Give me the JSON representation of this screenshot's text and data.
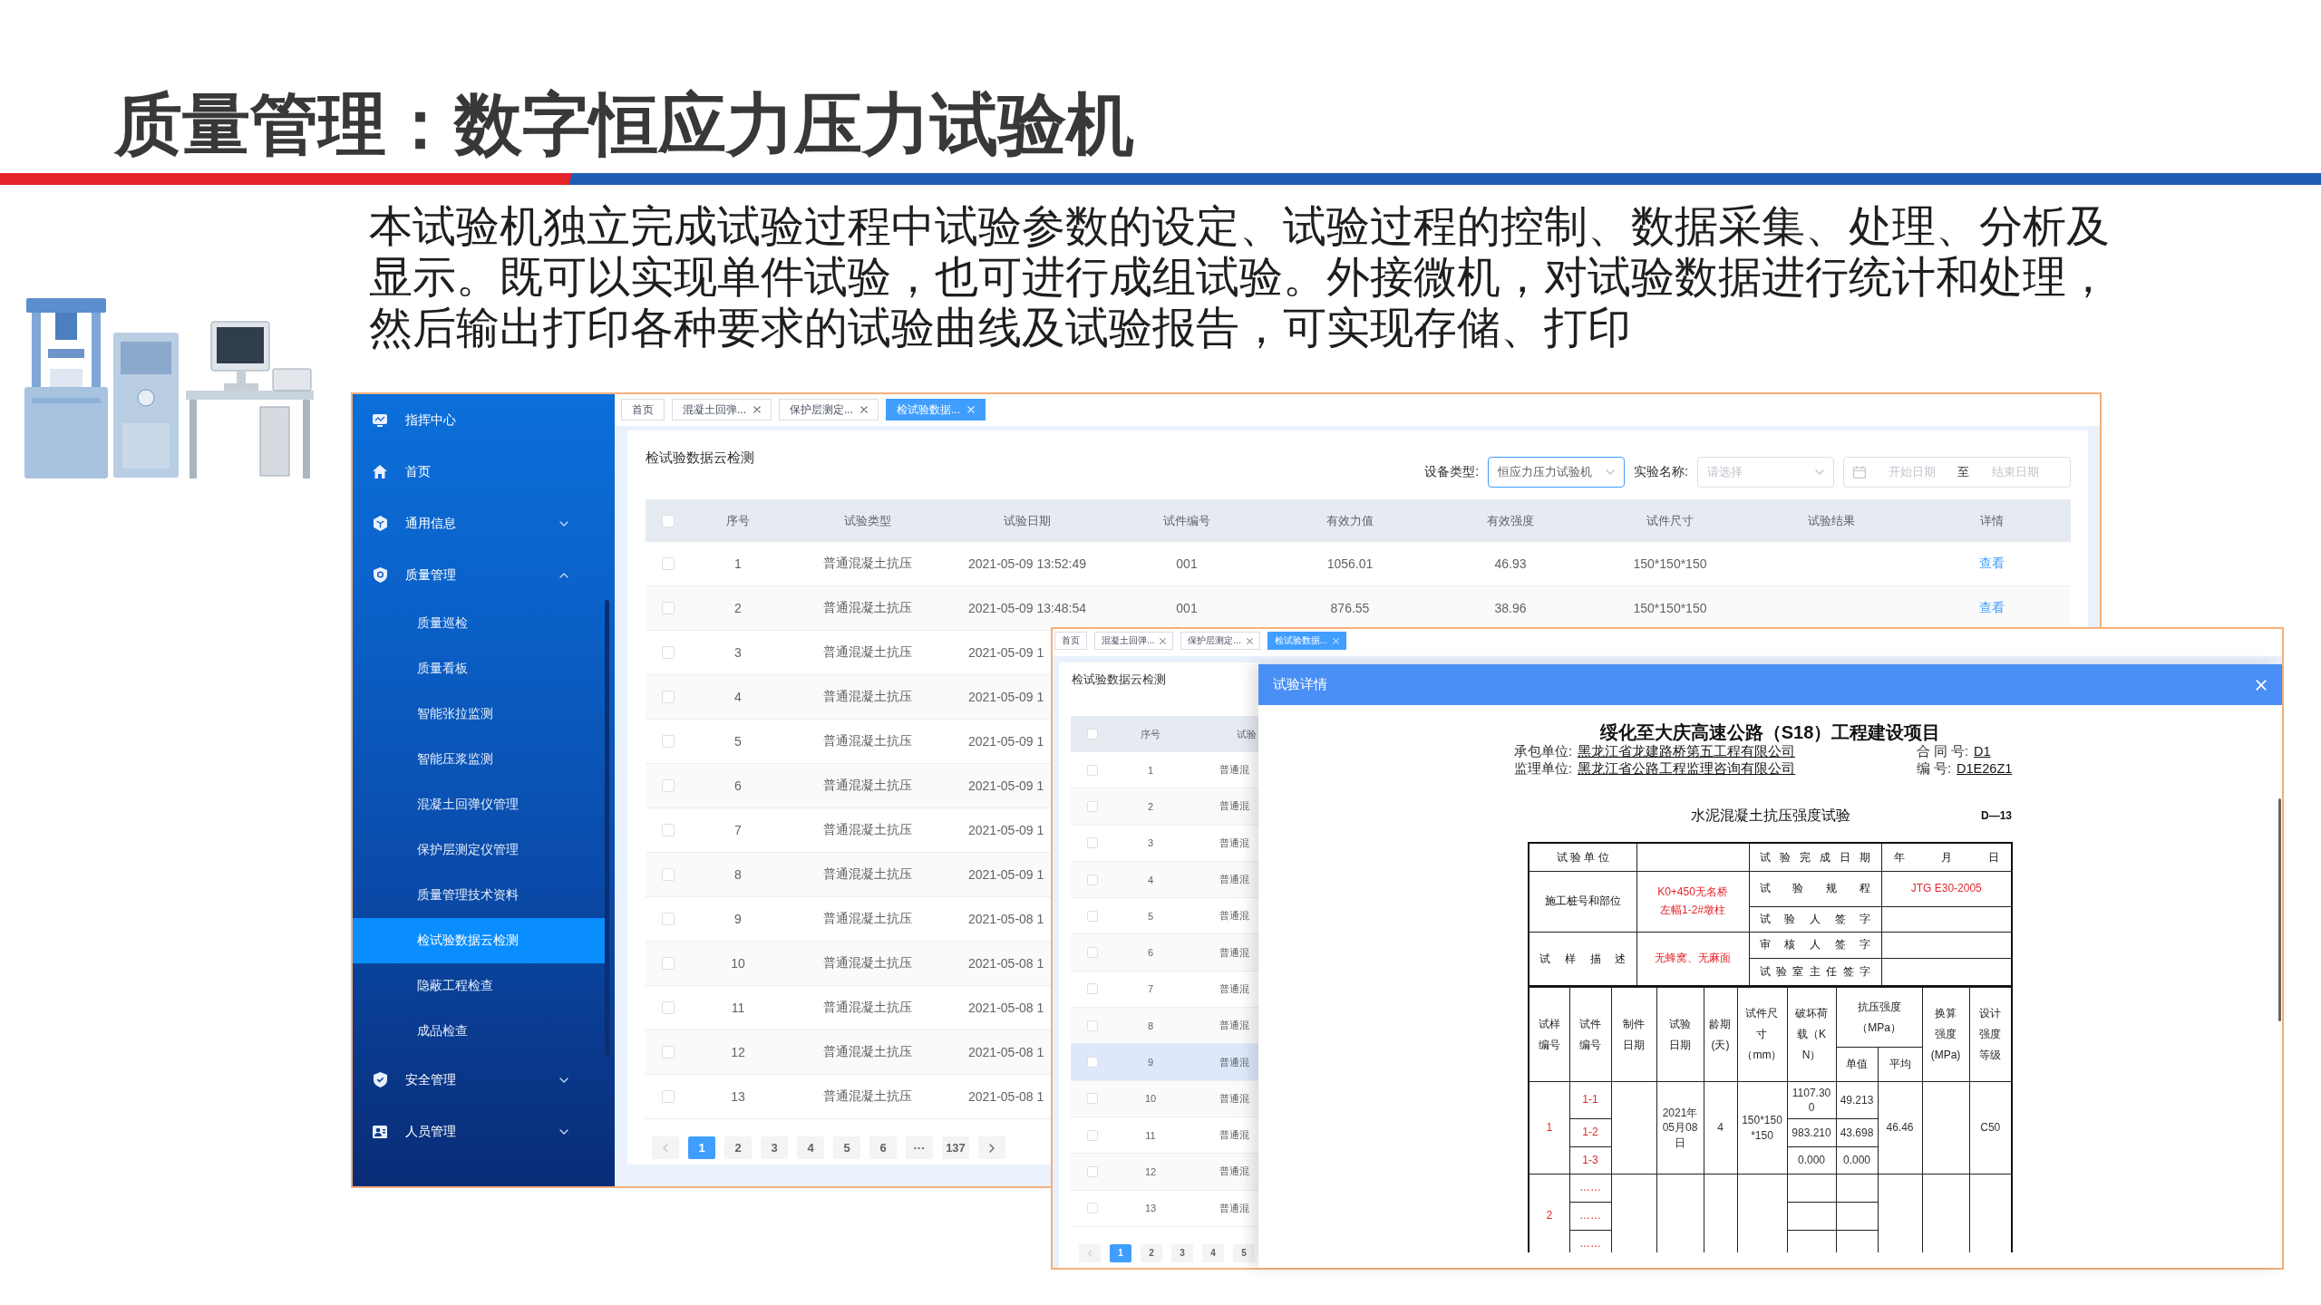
{
  "slide": {
    "title": "质量管理：数字恒应力压力试验机",
    "description": "本试验机独立完成试验过程中试验参数的设定、试验过程的控制、数据采集、处理、分析及显示。既可以实现单件试验，也可进行成组试验。外接微机，对试验数据进行统计和处理，然后输出打印各种要求的试验曲线及试验报告，可实现存储、打印"
  },
  "app": {
    "sidebar": {
      "items": [
        {
          "label": "指挥中心",
          "kind": "link"
        },
        {
          "label": "首页",
          "kind": "link"
        },
        {
          "label": "通用信息",
          "kind": "group",
          "expanded": false
        },
        {
          "label": "质量管理",
          "kind": "group",
          "expanded": true,
          "children": [
            {
              "label": "质量巡检",
              "selected": false
            },
            {
              "label": "质量看板",
              "selected": false
            },
            {
              "label": "智能张拉监测",
              "selected": false
            },
            {
              "label": "智能压浆监测",
              "selected": false
            },
            {
              "label": "混凝土回弹仪管理",
              "selected": false
            },
            {
              "label": "保护层测定仪管理",
              "selected": false
            },
            {
              "label": "质量管理技术资料",
              "selected": false
            },
            {
              "label": "检试验数据云检测",
              "selected": true
            },
            {
              "label": "隐蔽工程检查",
              "selected": false
            },
            {
              "label": "成品检查",
              "selected": false
            }
          ]
        },
        {
          "label": "安全管理",
          "kind": "group",
          "expanded": false
        },
        {
          "label": "人员管理",
          "kind": "group",
          "expanded": false
        }
      ]
    },
    "tabs": [
      {
        "label": "首页",
        "closable": false,
        "selected": false
      },
      {
        "label": "混凝土回弹...",
        "closable": true,
        "selected": false
      },
      {
        "label": "保护层测定...",
        "closable": true,
        "selected": false
      },
      {
        "label": "检试验数据...",
        "closable": true,
        "selected": true
      }
    ],
    "page_title": "检试验数据云检测",
    "filters": [
      {
        "kind": "select",
        "label": "设备类型:",
        "value": "恒应力压力试验机",
        "focused": true
      },
      {
        "kind": "select",
        "label": "实验名称:",
        "placeholder": "请选择",
        "focused": false
      },
      {
        "kind": "date_range",
        "start_placeholder": "开始日期",
        "separator": "至",
        "end_placeholder": "结束日期"
      }
    ],
    "table": {
      "all_checked": false,
      "columns": [
        {
          "label": "序号"
        },
        {
          "label": "试验类型"
        },
        {
          "label": "试验日期"
        },
        {
          "label": "试件编号"
        },
        {
          "label": "有效力值"
        },
        {
          "label": "有效强度"
        },
        {
          "label": "试件尺寸"
        },
        {
          "label": "试验结果"
        },
        {
          "label": "详情",
          "kind": "link"
        }
      ],
      "rows": [
        {
          "checked": false,
          "cells": [
            "1",
            "普通混凝土抗压",
            "2021-05-09 13:52:49",
            "001",
            "1056.01",
            "46.93",
            "150*150*150",
            null,
            "查看"
          ]
        },
        {
          "checked": false,
          "cells": [
            "2",
            "普通混凝土抗压",
            "2021-05-09 13:48:54",
            "001",
            "876.55",
            "38.96",
            "150*150*150",
            null,
            "查看"
          ]
        },
        {
          "checked": false,
          "cells": [
            "3",
            "普通混凝土抗压",
            "2021-05-09 1"
          ]
        },
        {
          "checked": false,
          "cells": [
            "4",
            "普通混凝土抗压",
            "2021-05-09 1"
          ]
        },
        {
          "checked": false,
          "cells": [
            "5",
            "普通混凝土抗压",
            "2021-05-09 1"
          ]
        },
        {
          "checked": false,
          "cells": [
            "6",
            "普通混凝土抗压",
            "2021-05-09 1"
          ]
        },
        {
          "checked": false,
          "cells": [
            "7",
            "普通混凝土抗压",
            "2021-05-09 1"
          ]
        },
        {
          "checked": false,
          "cells": [
            "8",
            "普通混凝土抗压",
            "2021-05-09 1"
          ]
        },
        {
          "checked": false,
          "cells": [
            "9",
            "普通混凝土抗压",
            "2021-05-08 1"
          ]
        },
        {
          "checked": false,
          "cells": [
            "10",
            "普通混凝土抗压",
            "2021-05-08 1"
          ]
        },
        {
          "checked": false,
          "cells": [
            "11",
            "普通混凝土抗压",
            "2021-05-08 1"
          ]
        },
        {
          "checked": false,
          "cells": [
            "12",
            "普通混凝土抗压",
            "2021-05-08 1"
          ]
        },
        {
          "checked": false,
          "cells": [
            "13",
            "普通混凝土抗压",
            "2021-05-08 1"
          ]
        }
      ]
    },
    "pagination": {
      "pages": [
        {
          "label": "1",
          "selected": true
        },
        {
          "label": "2",
          "selected": false
        },
        {
          "label": "3",
          "selected": false
        },
        {
          "label": "4",
          "selected": false
        },
        {
          "label": "5",
          "selected": false
        },
        {
          "label": "6",
          "selected": false
        },
        {
          "label": "···",
          "selected": false
        },
        {
          "label": "137",
          "selected": false
        }
      ]
    }
  },
  "second_window": {
    "tabs": [
      {
        "label": "首页",
        "closable": false,
        "selected": false
      },
      {
        "label": "混凝土回弹...",
        "closable": true,
        "selected": false
      },
      {
        "label": "保护层测定...",
        "closable": true,
        "selected": false
      },
      {
        "label": "检试验数据...",
        "closable": true,
        "selected": true
      }
    ],
    "page_title": "检试验数据云检测",
    "table": {
      "all_checked": false,
      "columns": [
        {
          "label": "序号"
        },
        {
          "label": "试验"
        }
      ],
      "rows": [
        {
          "checked": false,
          "highlighted": false,
          "cells": [
            "1",
            "普通混"
          ]
        },
        {
          "checked": false,
          "highlighted": false,
          "cells": [
            "2",
            "普通混"
          ]
        },
        {
          "checked": false,
          "highlighted": false,
          "cells": [
            "3",
            "普通混"
          ]
        },
        {
          "checked": false,
          "highlighted": false,
          "cells": [
            "4",
            "普通混"
          ]
        },
        {
          "checked": false,
          "highlighted": false,
          "cells": [
            "5",
            "普通混"
          ]
        },
        {
          "checked": false,
          "highlighted": false,
          "cells": [
            "6",
            "普通混"
          ]
        },
        {
          "checked": false,
          "highlighted": false,
          "cells": [
            "7",
            "普通混"
          ]
        },
        {
          "checked": false,
          "highlighted": false,
          "cells": [
            "8",
            "普通混"
          ]
        },
        {
          "checked": false,
          "highlighted": true,
          "cells": [
            "9",
            "普通混"
          ]
        },
        {
          "checked": false,
          "highlighted": false,
          "cells": [
            "10",
            "普通混"
          ]
        },
        {
          "checked": false,
          "highlighted": false,
          "cells": [
            "11",
            "普通混"
          ]
        },
        {
          "checked": false,
          "highlighted": false,
          "cells": [
            "12",
            "普通混"
          ]
        },
        {
          "checked": false,
          "highlighted": false,
          "cells": [
            "13",
            "普通混"
          ]
        }
      ]
    },
    "pagination": {
      "pages": [
        {
          "label": "1",
          "selected": true
        },
        {
          "label": "2",
          "selected": false
        },
        {
          "label": "3",
          "selected": false
        },
        {
          "label": "4",
          "selected": false
        },
        {
          "label": "5",
          "selected": false
        }
      ]
    },
    "dialog": {
      "title": "试验详情",
      "report": {
        "heading": "绥化至大庆高速公路（S18）工程建设项目",
        "info": [
          {
            "label": "承包单位:",
            "value": "黑龙江省龙建路桥第五工程有限公司"
          },
          {
            "label": "合 同 号:",
            "value": "D1"
          },
          {
            "label": "监理单位:",
            "value": "黑龙江省公路工程监理咨询有限公司"
          },
          {
            "label": "编 号:",
            "value": "D1E26Z1"
          }
        ],
        "form_title": "水泥混凝土抗压强度试验",
        "form_code": "D—13",
        "summary_rows": [
          [
            {
              "kind": "label",
              "text": "试 验 单 位"
            },
            {
              "kind": "blank"
            },
            {
              "kind": "spaced",
              "text": "试 验 完 成 日 期"
            },
            {
              "kind": "spread",
              "parts": [
                "年",
                "月",
                "日"
              ]
            }
          ],
          [
            {
              "kind": "label",
              "text": "施工桩号和部位",
              "rowspan": 2
            },
            {
              "kind": "entry",
              "text": "K0+450无名桥左幅1-2#墩柱",
              "rowspan": 2
            },
            {
              "kind": "spaced",
              "text": "试 验 规 程"
            },
            {
              "kind": "entry",
              "text": "JTG E30-2005"
            }
          ],
          [
            {
              "kind": "spaced",
              "text": "试 验 人 签 字"
            },
            {
              "kind": "blank"
            }
          ],
          [
            {
              "kind": "spaced",
              "text": "试 样 描 述",
              "rowspan": 2
            },
            {
              "kind": "entry",
              "text": "无蜂窝、无麻面",
              "rowspan": 2
            },
            {
              "kind": "spaced",
              "text": "审 核 人 签 字"
            },
            {
              "kind": "blank"
            }
          ],
          [
            {
              "kind": "spaced",
              "text": "试 验 室 主 任 签 字"
            },
            {
              "kind": "blank"
            }
          ]
        ],
        "result_rows": [
          [
            {
              "kind": "header",
              "text": "试样编号",
              "rowspan": 2
            },
            {
              "kind": "header",
              "text": "试件编号",
              "rowspan": 2
            },
            {
              "kind": "header",
              "text": "制件日期",
              "rowspan": 2
            },
            {
              "kind": "header",
              "text": "试验日期",
              "rowspan": 2
            },
            {
              "kind": "header",
              "text": "龄期(天)",
              "rowspan": 2
            },
            {
              "kind": "header",
              "text": "试件尺寸（mm）",
              "rowspan": 2
            },
            {
              "kind": "header",
              "text": "破坏荷载（KN）",
              "rowspan": 2
            },
            {
              "kind": "header",
              "text": "抗压强度（MPa）",
              "colspan": 2
            },
            {
              "kind": "header",
              "text": "换算强度(MPa)",
              "rowspan": 2
            },
            {
              "kind": "header",
              "text": "设计强度等级",
              "rowspan": 2
            }
          ],
          [
            {
              "kind": "header",
              "text": "单值"
            },
            {
              "kind": "header",
              "text": "平均"
            }
          ],
          [
            {
              "kind": "entry",
              "text": "1",
              "rowspan": 3
            },
            {
              "kind": "entry",
              "text": "1-1"
            },
            {
              "kind": "blank",
              "rowspan": 3
            },
            {
              "kind": "value",
              "text": "2021年05月08日",
              "rowspan": 3
            },
            {
              "kind": "value",
              "text": "4",
              "rowspan": 3
            },
            {
              "kind": "value",
              "text": "150*150*150",
              "rowspan": 3
            },
            {
              "kind": "value",
              "text": "1107.300"
            },
            {
              "kind": "value",
              "text": "49.213"
            },
            {
              "kind": "value",
              "text": "46.46",
              "rowspan": 3
            },
            {
              "kind": "blank",
              "rowspan": 3
            },
            {
              "kind": "value",
              "text": "C50",
              "rowspan": 3
            }
          ],
          [
            {
              "kind": "entry",
              "text": "1-2"
            },
            {
              "kind": "value",
              "text": "983.210"
            },
            {
              "kind": "value",
              "text": "43.698"
            }
          ],
          [
            {
              "kind": "entry",
              "text": "1-3"
            },
            {
              "kind": "value",
              "text": "0.000"
            },
            {
              "kind": "value",
              "text": "0.000"
            }
          ],
          [
            {
              "kind": "entry",
              "text": "2",
              "rowspan": 3
            },
            {
              "kind": "entry",
              "text": "……"
            },
            {
              "kind": "blank",
              "rowspan": 3
            },
            {
              "kind": "blank",
              "rowspan": 3
            },
            {
              "kind": "blank",
              "rowspan": 3
            },
            {
              "kind": "blank",
              "rowspan": 3
            },
            {
              "kind": "blank"
            },
            {
              "kind": "blank"
            },
            {
              "kind": "blank",
              "rowspan": 3
            },
            {
              "kind": "blank",
              "rowspan": 3
            },
            {
              "kind": "blank",
              "rowspan": 3
            }
          ],
          [
            {
              "kind": "entry",
              "text": "……"
            },
            {
              "kind": "blank"
            },
            {
              "kind": "blank"
            }
          ],
          [
            {
              "kind": "entry",
              "text": "……"
            },
            {
              "kind": "blank"
            },
            {
              "kind": "blank"
            }
          ]
        ]
      }
    }
  }
}
